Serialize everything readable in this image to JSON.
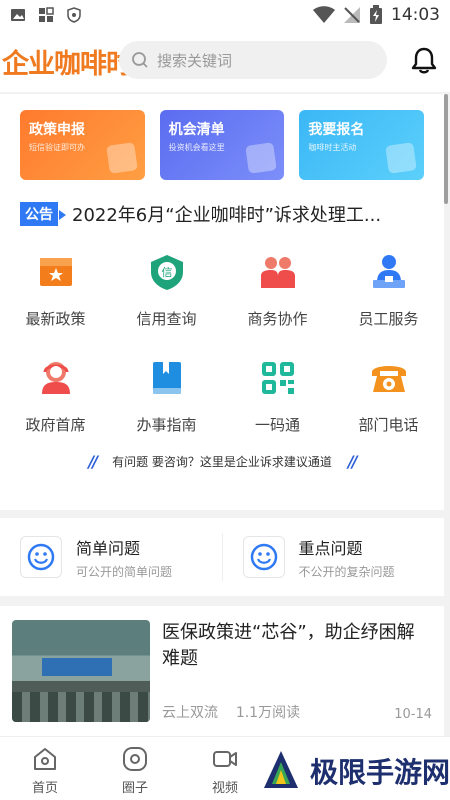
{
  "status": {
    "time": "14:03"
  },
  "header": {
    "logo": "企业咖啡时",
    "search_placeholder": "搜索关键词"
  },
  "banners": [
    {
      "title": "政策申报",
      "sub": "短信验证即可办"
    },
    {
      "title": "机会清单",
      "sub": "投资机会看这里"
    },
    {
      "title": "我要报名",
      "sub": "咖啡时主活动"
    }
  ],
  "notice": {
    "tag": "公告",
    "text": "2022年6月“企业咖啡时”诉求处理工..."
  },
  "services": [
    {
      "label": "最新政策",
      "icon": "policy-icon",
      "color": "#f47d1b"
    },
    {
      "label": "信用查询",
      "icon": "credit-icon",
      "color": "#1ea37a"
    },
    {
      "label": "商务协作",
      "icon": "cooperation-icon",
      "color": "#ef4c4c"
    },
    {
      "label": "员工服务",
      "icon": "staff-icon",
      "color": "#2f7af4"
    },
    {
      "label": "政府首席",
      "icon": "government-icon",
      "color": "#ef4c4c"
    },
    {
      "label": "办事指南",
      "icon": "guide-icon",
      "color": "#1f8ee0"
    },
    {
      "label": "一码通",
      "icon": "qrcode-icon",
      "color": "#1fb89a"
    },
    {
      "label": "部门电话",
      "icon": "phone-icon",
      "color": "#f4921f"
    }
  ],
  "tip": "有问题 要咨询？这里是企业诉求建议通道",
  "questions": [
    {
      "title": "简单问题",
      "sub": "可公开的简单问题"
    },
    {
      "title": "重点问题",
      "sub": "不公开的复杂问题"
    }
  ],
  "news": {
    "title": "医保政策进“芯谷”，助企纾困解难题",
    "source": "云上双流",
    "reads": "1.1万阅读",
    "date": "10-14"
  },
  "tabs": [
    {
      "label": "首页"
    },
    {
      "label": "圈子"
    },
    {
      "label": "视频"
    }
  ],
  "watermark": "极限手游网"
}
